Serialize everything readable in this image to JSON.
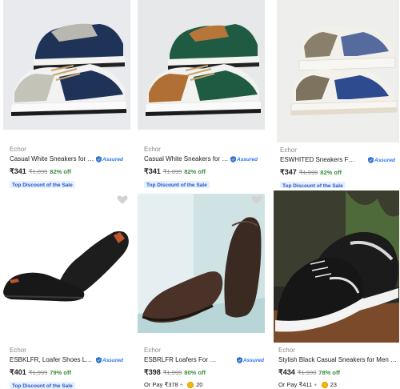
{
  "assured_label": "Assured",
  "colors": {
    "accent": "#2874f0",
    "discount": "#388e3c",
    "badge_bg": "#e7f0ff",
    "badge_text": "#2455c4",
    "muted": "#878787"
  },
  "products": [
    {
      "brand": "Echor",
      "title": "Casual White Sneakers for Men ...",
      "assured": true,
      "price": "₹341",
      "mrp": "₹1,099",
      "discount": "82% off",
      "badge": "Top Discount of the Sale",
      "image": "navy-grey-sneakers-image"
    },
    {
      "brand": "Echor",
      "title": "Casual White Sneakers for Men ...",
      "assured": true,
      "price": "₹341",
      "mrp": "₹1,099",
      "discount": "82% off",
      "badge": "Top Discount of the Sale",
      "image": "green-brown-sneakers-image"
    },
    {
      "brand": "Echor",
      "title": "ESWHITED Sneakers For Men",
      "assured": true,
      "price": "₹347",
      "mrp": "₹1,999",
      "discount": "82% off",
      "badge": "Top Discount of the Sale",
      "image": "printed-white-sneakers-image"
    },
    {
      "brand": "Echor",
      "title": "ESBKLFR, Loafer Shoes Loafers ...",
      "assured": true,
      "price": "₹401",
      "mrp": "₹1,999",
      "discount": "79% off",
      "badge": "Top Discount of the Sale",
      "image": "black-loafers-image"
    },
    {
      "brand": "Echor",
      "title": "ESBRLFR Loafers For Men",
      "assured": true,
      "price": "₹398",
      "mrp": "₹1,999",
      "discount": "80% off",
      "pay_prefix": "Or Pay",
      "pay_price": "₹378",
      "pay_coins": "20",
      "image": "brown-loafers-image"
    },
    {
      "brand": "Echor",
      "title": "Stylish Black Casual Sneakers for Men ~ Tren...",
      "assured": false,
      "price": "₹434",
      "mrp": "₹1,999",
      "discount": "78% off",
      "pay_prefix": "Or Pay",
      "pay_price": "₹411",
      "pay_coins": "23",
      "image": "black-sneakers-image"
    }
  ]
}
